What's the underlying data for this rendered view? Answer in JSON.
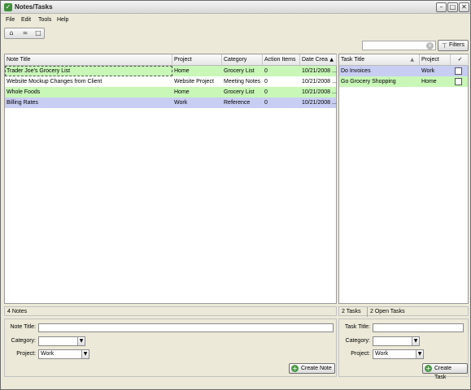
{
  "window": {
    "title": "Notes/Tasks"
  },
  "menu": [
    "File",
    "Edit",
    "Tools",
    "Help"
  ],
  "toolbar": {
    "icons": [
      "home-icon",
      "binoculars-icon",
      "blank-page-icon"
    ]
  },
  "search": {
    "value": "",
    "placeholder": ""
  },
  "filters_label": "Filters",
  "notes": {
    "columns": [
      "Note Title",
      "Project",
      "Category",
      "Action Items",
      "Date Crea"
    ],
    "rows": [
      {
        "title": "Trader Joe's Grocery List",
        "project": "Home",
        "category": "Grocery List",
        "actions": "0",
        "date": "10/21/2008 ...",
        "color": "green"
      },
      {
        "title": "Website Mockup Changes from Client",
        "project": "Website Project",
        "category": "Meeting Notes",
        "actions": "0",
        "date": "10/21/2008 ...",
        "color": "white"
      },
      {
        "title": "Whole Foods",
        "project": "Home",
        "category": "Grocery List",
        "actions": "0",
        "date": "10/21/2008 ...",
        "color": "green"
      },
      {
        "title": "Billing Rates",
        "project": "Work",
        "category": "Reference",
        "actions": "0",
        "date": "10/21/2008 ...",
        "color": "blue"
      }
    ],
    "status": "4 Notes",
    "form": {
      "title_label": "Note Title:",
      "category_label": "Category:",
      "project_label": "Project:",
      "title_value": "",
      "category_value": "",
      "project_value": "Work",
      "create_label": "Create Note"
    }
  },
  "tasks": {
    "columns": [
      "Task Title",
      "Project",
      "✓"
    ],
    "rows": [
      {
        "title": "Do Invoices",
        "project": "Work",
        "checked": false,
        "color": "blue"
      },
      {
        "title": "Go Grocery Shopping",
        "project": "Home",
        "checked": false,
        "color": "green"
      }
    ],
    "status_count": "2 Tasks",
    "status_open": "2 Open Tasks",
    "form": {
      "title_label": "Task Title:",
      "category_label": "Category:",
      "project_label": "Project:",
      "title_value": "",
      "category_value": "",
      "project_value": "Work",
      "create_label": "Create Task"
    }
  },
  "colors": {
    "green": "#c8f7b8",
    "blue": "#c8cdf2",
    "white": "#ffffff"
  }
}
